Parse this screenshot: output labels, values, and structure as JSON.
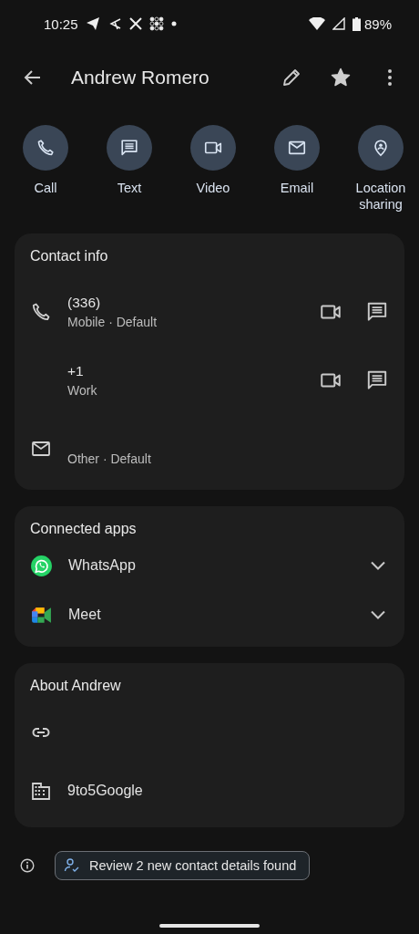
{
  "status_bar": {
    "time": "10:25",
    "battery": "89%"
  },
  "app_bar": {
    "title": "Andrew Romero",
    "starred": true
  },
  "actions": [
    {
      "kind": "phone",
      "label": "Call"
    },
    {
      "kind": "message",
      "label": "Text"
    },
    {
      "kind": "video",
      "label": "Video"
    },
    {
      "kind": "email",
      "label": "Email"
    },
    {
      "kind": "location",
      "label": "Location sharing"
    }
  ],
  "contact_info": {
    "title": "Contact info",
    "rows": [
      {
        "kind": "phone",
        "primary": "(336)",
        "secondary": "Mobile · Default",
        "actions": [
          {
            "kind": "video"
          },
          {
            "kind": "message"
          }
        ]
      },
      {
        "kind": "none",
        "primary": "+1",
        "secondary": "Work",
        "actions": [
          {
            "kind": "video"
          },
          {
            "kind": "message"
          }
        ]
      },
      {
        "kind": "email",
        "secondary": "Other · Default",
        "actions": []
      }
    ]
  },
  "connected_apps": {
    "title": "Connected apps",
    "apps": [
      {
        "kind": "whatsapp",
        "name": "WhatsApp",
        "expanded": false
      },
      {
        "kind": "meet",
        "name": "Meet",
        "expanded": false
      }
    ]
  },
  "about": {
    "title": "About Andrew",
    "rows": [
      {
        "kind": "link"
      },
      {
        "kind": "building",
        "text": "9to5Google"
      }
    ]
  },
  "review_chip": {
    "label": "Review 2 new contact details found"
  }
}
